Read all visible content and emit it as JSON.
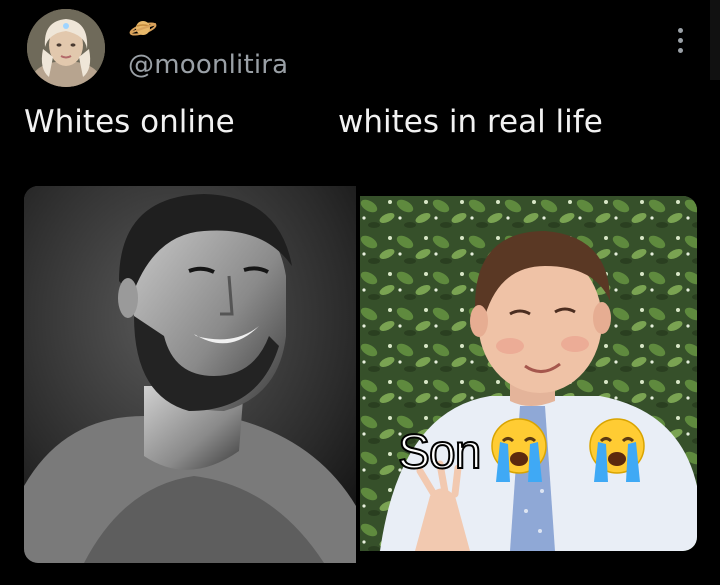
{
  "post": {
    "author": {
      "handle": "@moonlitira",
      "badge_icon": "ringed-planet-icon"
    },
    "more_icon": "more-vertical-icon"
  },
  "meme": {
    "left_caption": "Whites online",
    "right_caption": "whites in real life",
    "overlay_text": "Son",
    "overlay_emoji": [
      "loudly-crying-face-icon",
      "loudly-crying-face-icon"
    ]
  },
  "colors": {
    "background": "#000000",
    "handle_text": "#9aa0a6",
    "caption_text": "#f2f2f2"
  }
}
